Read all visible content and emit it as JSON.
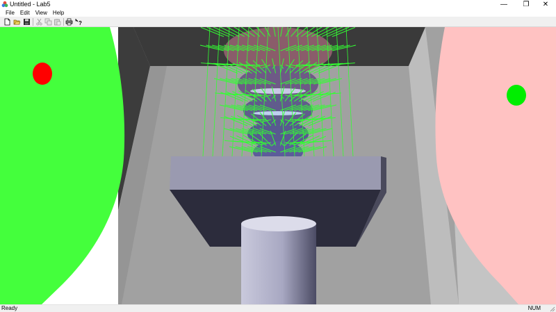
{
  "window": {
    "title": "Untitled - Lab5",
    "minimize_glyph": "—",
    "maximize_glyph": "❐",
    "close_glyph": "✕"
  },
  "menu": {
    "items": [
      "File",
      "Edit",
      "View",
      "Help"
    ]
  },
  "toolbar": {
    "buttons": [
      {
        "icon": "new-document-icon",
        "enabled": true
      },
      {
        "icon": "open-folder-icon",
        "enabled": true
      },
      {
        "icon": "save-icon",
        "enabled": true
      },
      {
        "icon": "cut-icon",
        "enabled": false
      },
      {
        "icon": "copy-icon",
        "enabled": false
      },
      {
        "icon": "paste-icon",
        "enabled": false
      },
      {
        "icon": "print-icon",
        "enabled": true
      },
      {
        "icon": "help-icon",
        "enabled": true
      }
    ]
  },
  "scene": {
    "colors": {
      "left_wall": "#ffffff",
      "left_disc": "#44ff3c",
      "left_dot": "#ff0000",
      "right_disc": "#ffc2c2",
      "right_dot": "#00ee00",
      "back_wall": "#3a3a3a",
      "floor": "#a1a1a1",
      "side_wall": "#c4c4c4",
      "table": "#8a8aa0",
      "normals": "#32ff32",
      "pillar": "#c2c2d6"
    }
  },
  "status": {
    "text": "Ready",
    "indicator": "NUM"
  }
}
